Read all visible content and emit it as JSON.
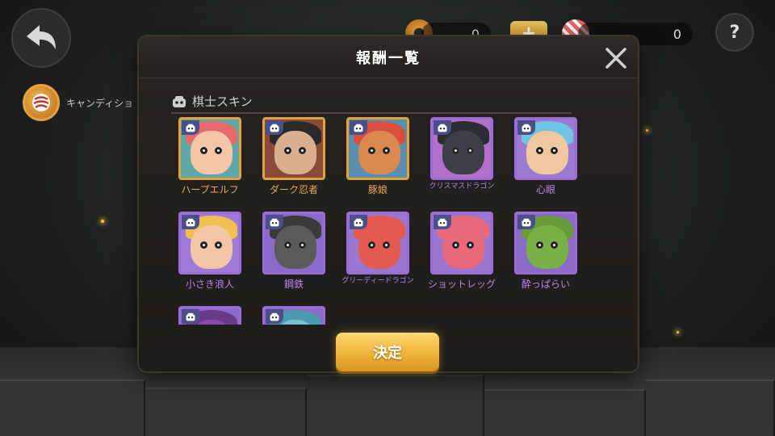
{
  "hud": {
    "currency_1_value": "0",
    "currency_2_value": "0",
    "plus_label": "+",
    "help_label": "?",
    "side_tab_label": "キャンディショ"
  },
  "dialog": {
    "title": "報酬一覧",
    "section_label": "棋士スキン",
    "confirm_label": "決定"
  },
  "items": [
    {
      "name": "ハープエルフ",
      "rarity": "gold"
    },
    {
      "name": "ダーク忍者",
      "rarity": "gold"
    },
    {
      "name": "豚娘",
      "rarity": "gold"
    },
    {
      "name": "クリスマスドラゴン",
      "rarity": "purple"
    },
    {
      "name": "心眼",
      "rarity": "purple"
    },
    {
      "name": "小さき浪人",
      "rarity": "purple"
    },
    {
      "name": "鋼鉄",
      "rarity": "purple"
    },
    {
      "name": "グリーディードラゴン",
      "rarity": "purple"
    },
    {
      "name": "ショットレッグ",
      "rarity": "purple"
    },
    {
      "name": "酔っぱらい",
      "rarity": "purple"
    },
    {
      "name": "",
      "rarity": "purple"
    },
    {
      "name": "",
      "rarity": "purple"
    }
  ],
  "colors": {
    "gold_border": "#e0a23a",
    "purple_border": "#9b6bd6",
    "gold_text": "#e8a850",
    "purple_text": "#b784ef",
    "button": "#f0b73a"
  }
}
